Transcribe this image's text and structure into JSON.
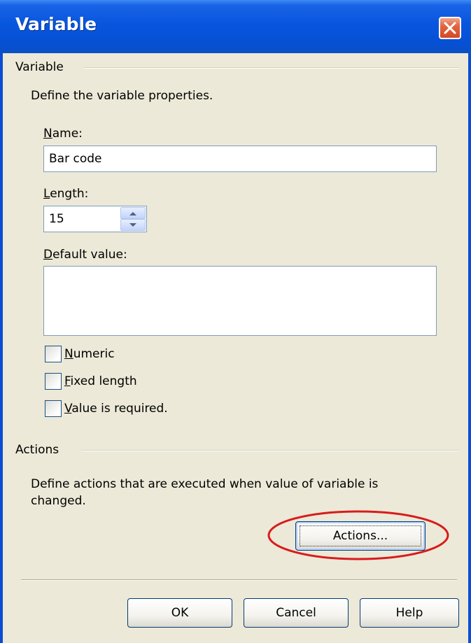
{
  "window": {
    "title": "Variable",
    "accent": "#0856de",
    "close_color": "#d24a25",
    "highlight_color": "#d81c1c"
  },
  "variable_group": {
    "label": "Variable",
    "description": "Define the variable properties.",
    "name": {
      "label_accel": "N",
      "label_rest": "ame:",
      "value": "Bar code"
    },
    "length": {
      "label_accel": "L",
      "label_rest": "ength:",
      "value": "15"
    },
    "default_value": {
      "label_accel": "D",
      "label_rest": "efault value:",
      "value": ""
    },
    "checkboxes": [
      {
        "accel": "N",
        "rest": "umeric",
        "checked": false
      },
      {
        "accel": "F",
        "rest": "ixed length",
        "checked": false
      },
      {
        "accel": "V",
        "rest": "alue is required.",
        "checked": false
      }
    ]
  },
  "actions_group": {
    "label": "Actions",
    "description_line1": "Define actions that are executed when value of variable is",
    "description_line2": "changed.",
    "button_label": "Actions..."
  },
  "footer": {
    "ok_label": "OK",
    "cancel_label": "Cancel",
    "help_label": "Help"
  }
}
